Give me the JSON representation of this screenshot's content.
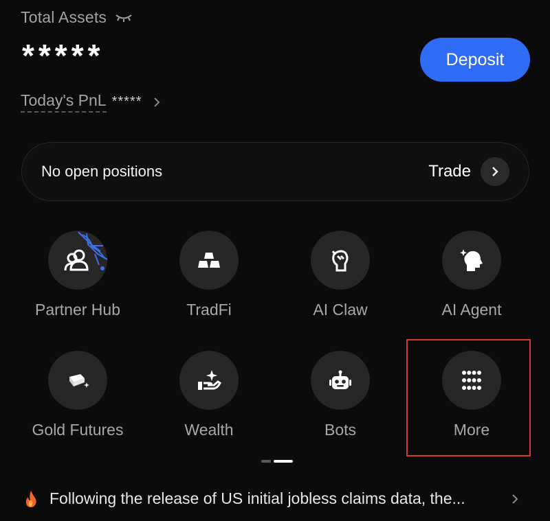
{
  "header": {
    "total_assets_label": "Total Assets",
    "masked_total": "*****",
    "deposit_label": "Deposit",
    "pnl_label": "Today's PnL",
    "pnl_value": "*****"
  },
  "positions": {
    "status": "No open positions",
    "trade_label": "Trade"
  },
  "shortcuts": [
    {
      "label": "Partner Hub",
      "icon": "partner-hub-icon"
    },
    {
      "label": "TradFi",
      "icon": "gold-bars-icon"
    },
    {
      "label": "AI Claw",
      "icon": "ai-claw-icon"
    },
    {
      "label": "AI Agent",
      "icon": "ai-agent-icon"
    },
    {
      "label": "Gold Futures",
      "icon": "gold-bar-sparkle-icon"
    },
    {
      "label": "Wealth",
      "icon": "hand-sparkle-icon"
    },
    {
      "label": "Bots",
      "icon": "robot-icon"
    },
    {
      "label": "More",
      "icon": "grid-dots-icon"
    }
  ],
  "news": {
    "text": "Following the release of US initial jobless claims data, the..."
  },
  "colors": {
    "accent": "#2f6cf6",
    "background": "#0b0b0b",
    "tile": "#262626",
    "highlight_frame": "#d8392f"
  }
}
